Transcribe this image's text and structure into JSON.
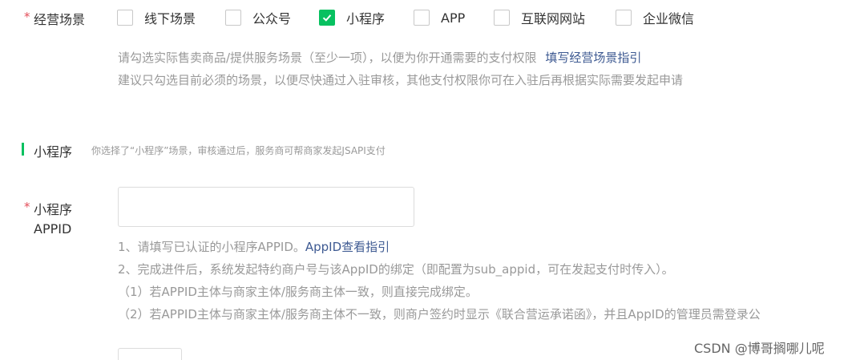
{
  "scene": {
    "required_mark": "*",
    "label": "经营场景",
    "options": [
      {
        "label": "线下场景",
        "checked": false
      },
      {
        "label": "公众号",
        "checked": false
      },
      {
        "label": "小程序",
        "checked": true
      },
      {
        "label": "APP",
        "checked": false
      },
      {
        "label": "互联网网站",
        "checked": false
      },
      {
        "label": "企业微信",
        "checked": false
      }
    ],
    "hint_line1": "请勾选实际售卖商品/提供服务场景（至少一项），以便为你开通需要的支付权限",
    "hint_link": "填写经营场景指引",
    "hint_line2": "建议只勾选目前必须的场景，以便尽快通过入驻审核，其他支付权限你可在入驻后再根据实际需要发起申请"
  },
  "section": {
    "title": "小程序",
    "desc": "你选择了“小程序”场景，审核通过后，服务商可帮商家发起JSAPI支付"
  },
  "appid": {
    "required_mark": "*",
    "label_line1": "小程序",
    "label_line2": "APPID",
    "value": "",
    "note1": "1、请填写已认证的小程序APPID。",
    "note1_link": "AppID查看指引",
    "note2": "2、完成进件后，系统发起特约商户号与该AppID的绑定（即配置为sub_appid，可在发起支付时传入）。",
    "note3": "（1）若APPID主体与商家主体/服务商主体一致，则直接完成绑定。",
    "note4": "（2）若APPID主体与商家主体/服务商主体不一致，则商户签约时显示《联合营运承诺函》，并且AppID的管理员需登录公"
  },
  "watermark": "CSDN @博哥搁哪儿呢",
  "colors": {
    "accent": "#07c160",
    "link": "#3e5a92",
    "required": "#e34d59"
  }
}
